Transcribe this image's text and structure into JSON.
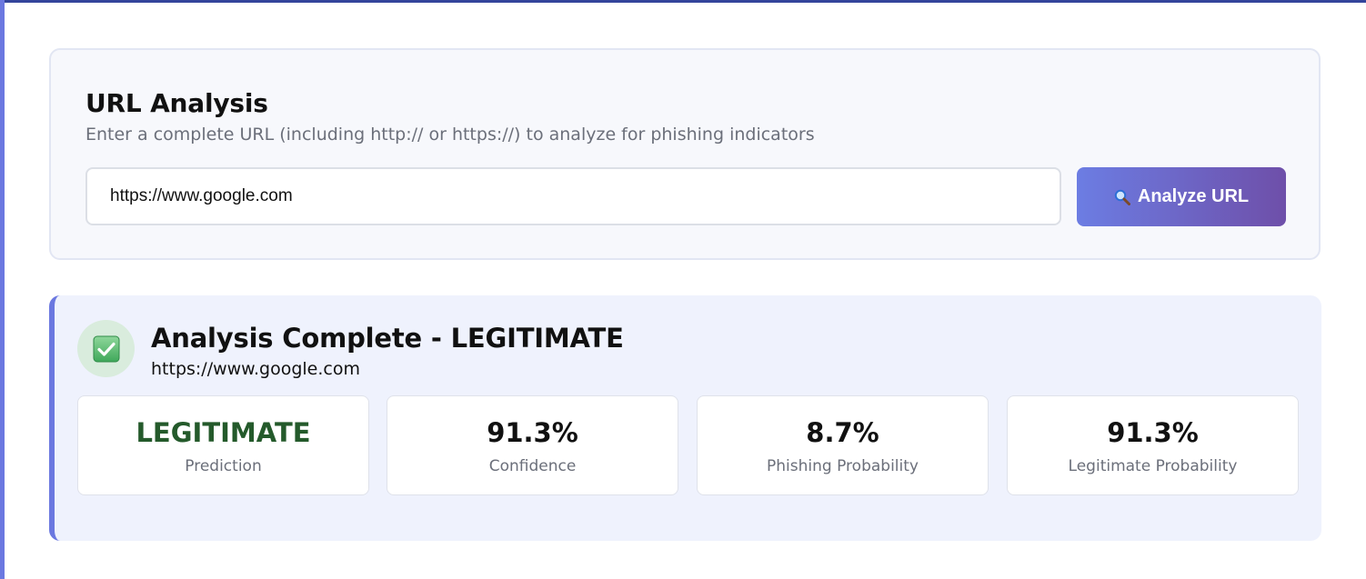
{
  "analysis_panel": {
    "title": "URL Analysis",
    "subtitle": "Enter a complete URL (including http:// or https://) to analyze for phishing indicators",
    "url_input_value": "https://www.google.com",
    "analyze_button_label": "Analyze URL",
    "analyze_button_icon": "search-icon"
  },
  "result": {
    "status_icon": "check-mark-icon",
    "title": "Analysis Complete - LEGITIMATE",
    "url": "https://www.google.com",
    "stats": [
      {
        "value": "LEGITIMATE",
        "label": "Prediction"
      },
      {
        "value": "91.3%",
        "label": "Confidence"
      },
      {
        "value": "8.7%",
        "label": "Phishing Probability"
      },
      {
        "value": "91.3%",
        "label": "Legitimate Probability"
      }
    ]
  },
  "colors": {
    "accent": "#6b78e0",
    "button_gradient_start": "#6c7de3",
    "button_gradient_end": "#6e4fa9",
    "legitimate_text": "#245a2b",
    "status_circle_bg": "#d9ecdd",
    "result_bg": "#eff2fd"
  }
}
